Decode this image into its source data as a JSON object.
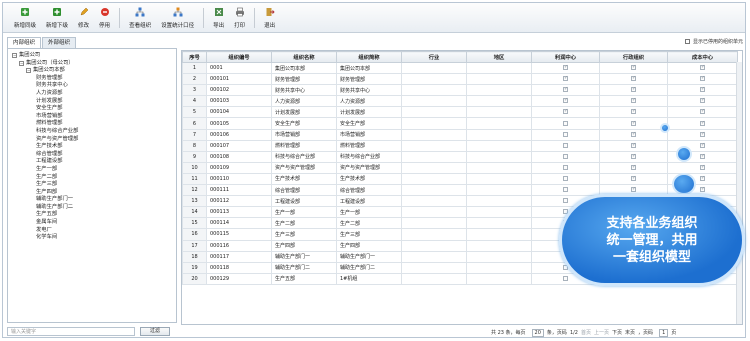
{
  "toolbar": {
    "buttons": [
      {
        "label": "新增同级",
        "icon": "add-sibling-icon"
      },
      {
        "label": "新增下级",
        "icon": "add-child-icon"
      },
      {
        "label": "修改",
        "icon": "edit-icon"
      },
      {
        "label": "停用",
        "icon": "disable-icon"
      },
      {
        "label": "查看组织",
        "icon": "view-org-icon"
      },
      {
        "label": "设置统计口径",
        "icon": "settings-stat-icon"
      },
      {
        "label": "导出",
        "icon": "export-icon"
      },
      {
        "label": "打印",
        "icon": "print-icon"
      },
      {
        "label": "退出",
        "icon": "exit-icon"
      }
    ]
  },
  "left": {
    "tabs": [
      "内部组织",
      "外部组织"
    ],
    "tree": {
      "root": "集团公司",
      "company": "集团公司（母公司）",
      "hq": "集团公司本部",
      "children": [
        "财务管理部",
        "财务共享中心",
        "人力资源部",
        "计划发展部",
        "安全生产部",
        "市场营销部",
        "燃料管理部",
        "科技与综合产业部",
        "资产与资产管理部",
        "生产技术部",
        "综合管理部",
        "工程建设部",
        "生产一部",
        "生产二部",
        "生产三部",
        "生产四部",
        "辅助生产部门一",
        "辅助生产部门二",
        "生产五部",
        "金属车间",
        "发电厂",
        "化学车间"
      ]
    },
    "search_placeholder": "输入关键字",
    "filter_label": "过滤"
  },
  "right": {
    "show_disabled_label": "显示已停用的组织单元",
    "columns": [
      "序号",
      "组织编号",
      "组织名称",
      "组织简称",
      "行业",
      "地区",
      "利润中心",
      "行政组织",
      "成本中心"
    ],
    "rows": [
      {
        "no": "1",
        "code": "0001",
        "name": "集团公司本部",
        "short": "集团公司本部",
        "profit": true,
        "admin": true,
        "cost": true
      },
      {
        "no": "2",
        "code": "000101",
        "name": "财务管理部",
        "short": "财务管理部",
        "profit": true,
        "admin": true,
        "cost": true
      },
      {
        "no": "3",
        "code": "000102",
        "name": "财务共享中心",
        "short": "财务共享中心",
        "profit": true,
        "admin": true,
        "cost": true
      },
      {
        "no": "4",
        "code": "000103",
        "name": "人力资源部",
        "short": "人力资源部",
        "profit": true,
        "admin": true,
        "cost": true
      },
      {
        "no": "5",
        "code": "000104",
        "name": "计划发展部",
        "short": "计划发展部",
        "profit": true,
        "admin": true,
        "cost": true
      },
      {
        "no": "6",
        "code": "000105",
        "name": "安全生产部",
        "short": "安全生产部",
        "profit": false,
        "admin": true,
        "cost": true
      },
      {
        "no": "7",
        "code": "000106",
        "name": "市场营销部",
        "short": "市场营销部",
        "profit": false,
        "admin": true,
        "cost": true
      },
      {
        "no": "8",
        "code": "000107",
        "name": "燃料管理部",
        "short": "燃料管理部",
        "profit": false,
        "admin": true,
        "cost": true
      },
      {
        "no": "9",
        "code": "000108",
        "name": "科技与综合产业部",
        "short": "科技与综合产业部",
        "profit": false,
        "admin": true,
        "cost": true
      },
      {
        "no": "10",
        "code": "000109",
        "name": "资产与资产管理部",
        "short": "资产与资产管理部",
        "profit": false,
        "admin": true,
        "cost": true
      },
      {
        "no": "11",
        "code": "000110",
        "name": "生产技术部",
        "short": "生产技术部",
        "profit": false,
        "admin": true,
        "cost": true
      },
      {
        "no": "12",
        "code": "000111",
        "name": "综合管理部",
        "short": "综合管理部",
        "profit": false,
        "admin": true,
        "cost": true
      },
      {
        "no": "13",
        "code": "000112",
        "name": "工程建设部",
        "short": "工程建设部",
        "profit": false,
        "admin": true,
        "cost": false
      },
      {
        "no": "14",
        "code": "000113",
        "name": "生产一部",
        "short": "生产一部",
        "profit": false,
        "admin": true,
        "cost": false
      },
      {
        "no": "15",
        "code": "000114",
        "name": "生产二部",
        "short": "生产二部",
        "profit": false,
        "admin": true,
        "cost": false
      },
      {
        "no": "16",
        "code": "000115",
        "name": "生产三部",
        "short": "生产三部",
        "profit": false,
        "admin": true,
        "cost": false
      },
      {
        "no": "17",
        "code": "000116",
        "name": "生产四部",
        "short": "生产四部",
        "profit": false,
        "admin": true,
        "cost": false
      },
      {
        "no": "18",
        "code": "000117",
        "name": "辅助生产部门一",
        "short": "辅助生产部门一",
        "profit": false,
        "admin": true,
        "cost": false
      },
      {
        "no": "19",
        "code": "000118",
        "name": "辅助生产部门二",
        "short": "辅助生产部门二",
        "profit": false,
        "admin": true,
        "cost": false
      },
      {
        "no": "20",
        "code": "000129",
        "name": "生产五部",
        "short": "1#机组",
        "profit": false,
        "admin": true,
        "cost": false
      }
    ],
    "pager": {
      "total": "共 23 条，每页",
      "page_size": "20",
      "per_page_unit": "条，页码",
      "page_info": "1/2",
      "first": "首页",
      "prev": "上一页",
      "next": "下页",
      "last": "末页",
      "jump_label": "，页码",
      "page_value": "1",
      "page_unit": "页"
    }
  },
  "callout": {
    "line1": "支持各业务组织",
    "line2": "统一管理，共用",
    "line3": "一套组织模型"
  },
  "colors": {
    "accent": "#1d6fd0",
    "border": "#b8c4d0"
  }
}
